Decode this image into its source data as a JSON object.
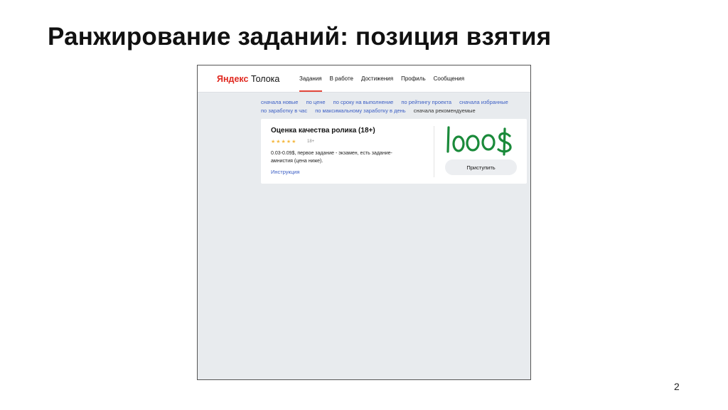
{
  "slide": {
    "title": "Ранжирование заданий: позиция взятия",
    "page_number": "2"
  },
  "app": {
    "logo_brand": "Яндекс",
    "logo_product": "Толока"
  },
  "nav": {
    "items": [
      {
        "label": "Задания",
        "active": true
      },
      {
        "label": "В работе"
      },
      {
        "label": "Достижения"
      },
      {
        "label": "Профиль"
      },
      {
        "label": "Сообщения"
      }
    ]
  },
  "sorting": {
    "options": [
      "сначала новые",
      "по цене",
      "по сроку на выполнение",
      "по рейтингу проекта",
      "сначала избранные",
      "по заработку в час",
      "по максимальному заработку в день"
    ],
    "current": "сначала рекомендуемые"
  },
  "task_card": {
    "title": "Оценка качества ролика (18+)",
    "rating_stars": "★★★★★",
    "age_label": "18+",
    "description": "0.03-0.09$, первое задание - экзамен, есть задание-амнистия (цена ниже).",
    "instruction_link": "Инструкция",
    "start_button": "Приступить",
    "handwritten_annotation": "1000$",
    "annotation_color": "#1a8a3a"
  }
}
